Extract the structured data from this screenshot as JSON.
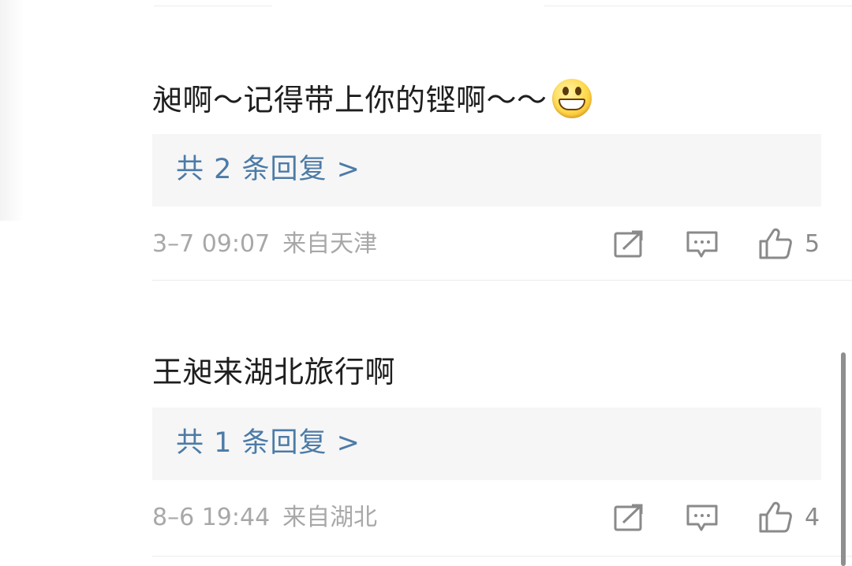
{
  "comments": [
    {
      "text": "昶啊～记得带上你的铿啊～～",
      "emoji": "grinning-face-emoji",
      "reply_summary": "共 2 条回复 >",
      "time": "3–7 09:07",
      "location": "来自天津",
      "likes": "5"
    },
    {
      "text": "王昶来湖北旅行啊",
      "reply_summary": "共 1 条回复 >",
      "time": "8–6 19:44",
      "location": "来自湖北",
      "likes": "4"
    }
  ],
  "icons": {
    "forward": "share-edit-icon",
    "comment": "comment-bubble-icon",
    "like": "thumbs-up-icon"
  },
  "colors": {
    "reply_link": "#4c7ba7",
    "meta_text": "#a8a8a8",
    "reply_box_bg": "#f6f6f6"
  }
}
